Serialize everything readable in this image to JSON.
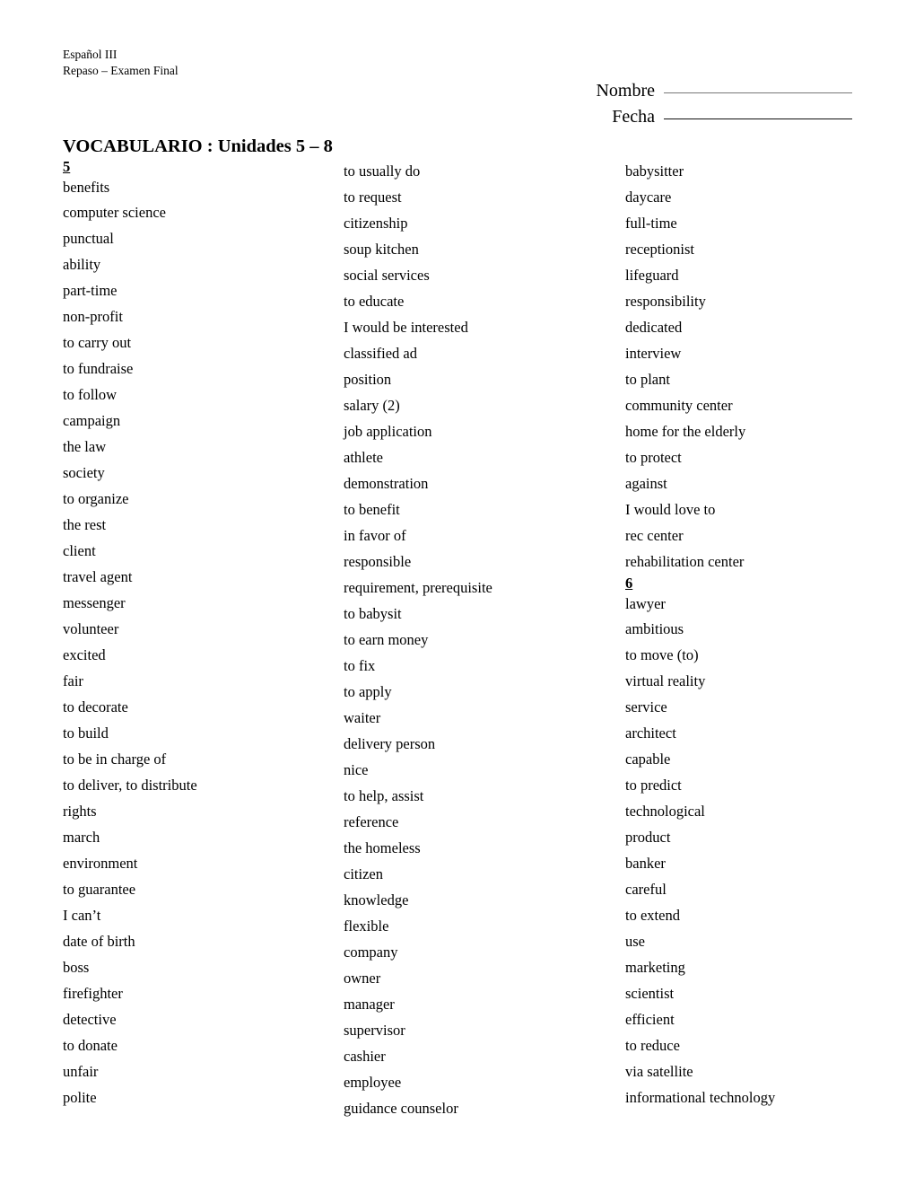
{
  "header": {
    "course": "Español III",
    "subtitle": "Repaso – Examen Final",
    "nombre_label": "Nombre",
    "fecha_label": "Fecha"
  },
  "title": "VOCABULARIO : Unidades 5 – 8",
  "columns": [
    {
      "id": "column-1",
      "items": [
        {
          "text": "5",
          "type": "section"
        },
        {
          "text": "benefits",
          "type": "word"
        },
        {
          "text": "computer science",
          "type": "word"
        },
        {
          "text": "punctual",
          "type": "word"
        },
        {
          "text": "ability",
          "type": "word"
        },
        {
          "text": "part-time",
          "type": "word"
        },
        {
          "text": "non-profit",
          "type": "word"
        },
        {
          "text": "to carry out",
          "type": "word"
        },
        {
          "text": "to fundraise",
          "type": "word"
        },
        {
          "text": "to follow",
          "type": "word"
        },
        {
          "text": "campaign",
          "type": "word"
        },
        {
          "text": "the law",
          "type": "word"
        },
        {
          "text": "society",
          "type": "word"
        },
        {
          "text": "to organize",
          "type": "word"
        },
        {
          "text": "the rest",
          "type": "word"
        },
        {
          "text": "client",
          "type": "word"
        },
        {
          "text": "travel agent",
          "type": "word"
        },
        {
          "text": "messenger",
          "type": "word"
        },
        {
          "text": "volunteer",
          "type": "word"
        },
        {
          "text": "excited",
          "type": "word"
        },
        {
          "text": "fair",
          "type": "word"
        },
        {
          "text": "to decorate",
          "type": "word"
        },
        {
          "text": "to build",
          "type": "word"
        },
        {
          "text": "to be in charge of",
          "type": "word"
        },
        {
          "text": "to deliver, to distribute",
          "type": "word"
        },
        {
          "text": "rights",
          "type": "word"
        },
        {
          "text": "march",
          "type": "word"
        },
        {
          "text": "environment",
          "type": "word"
        },
        {
          "text": "to guarantee",
          "type": "word"
        },
        {
          "text": "I can’t",
          "type": "word"
        },
        {
          "text": "date of birth",
          "type": "word"
        },
        {
          "text": "boss",
          "type": "word"
        },
        {
          "text": "firefighter",
          "type": "word"
        },
        {
          "text": "detective",
          "type": "word"
        },
        {
          "text": "to donate",
          "type": "word"
        },
        {
          "text": "unfair",
          "type": "word"
        },
        {
          "text": "polite",
          "type": "word"
        }
      ]
    },
    {
      "id": "column-2",
      "items": [
        {
          "text": "to usually do",
          "type": "word"
        },
        {
          "text": "to request",
          "type": "word"
        },
        {
          "text": "citizenship",
          "type": "word"
        },
        {
          "text": "soup kitchen",
          "type": "word"
        },
        {
          "text": "social services",
          "type": "word"
        },
        {
          "text": "to educate",
          "type": "word"
        },
        {
          "text": "I would be interested",
          "type": "word"
        },
        {
          "text": "classified ad",
          "type": "word"
        },
        {
          "text": "position",
          "type": "word"
        },
        {
          "text": "salary (2)",
          "type": "word"
        },
        {
          "text": "job application",
          "type": "word"
        },
        {
          "text": "athlete",
          "type": "word"
        },
        {
          "text": "demonstration",
          "type": "word"
        },
        {
          "text": "to benefit",
          "type": "word"
        },
        {
          "text": "in favor of",
          "type": "word"
        },
        {
          "text": "responsible",
          "type": "word"
        },
        {
          "text": "requirement, prerequisite",
          "type": "word"
        },
        {
          "text": "to babysit",
          "type": "word"
        },
        {
          "text": "to earn money",
          "type": "word"
        },
        {
          "text": "to fix",
          "type": "word"
        },
        {
          "text": "to apply",
          "type": "word"
        },
        {
          "text": "waiter",
          "type": "word"
        },
        {
          "text": "delivery person",
          "type": "word"
        },
        {
          "text": "nice",
          "type": "word"
        },
        {
          "text": "to help, assist",
          "type": "word"
        },
        {
          "text": "reference",
          "type": "word"
        },
        {
          "text": "the homeless",
          "type": "word"
        },
        {
          "text": "citizen",
          "type": "word"
        },
        {
          "text": "knowledge",
          "type": "word"
        },
        {
          "text": "flexible",
          "type": "word"
        },
        {
          "text": "company",
          "type": "word"
        },
        {
          "text": "owner",
          "type": "word"
        },
        {
          "text": "manager",
          "type": "word"
        },
        {
          "text": "supervisor",
          "type": "word"
        },
        {
          "text": "cashier",
          "type": "word"
        },
        {
          "text": "employee",
          "type": "word"
        },
        {
          "text": "guidance counselor",
          "type": "word"
        }
      ]
    },
    {
      "id": "column-3",
      "items": [
        {
          "text": "babysitter",
          "type": "word"
        },
        {
          "text": "daycare",
          "type": "word"
        },
        {
          "text": "full-time",
          "type": "word"
        },
        {
          "text": "receptionist",
          "type": "word"
        },
        {
          "text": "lifeguard",
          "type": "word"
        },
        {
          "text": "responsibility",
          "type": "word"
        },
        {
          "text": "dedicated",
          "type": "word"
        },
        {
          "text": "interview",
          "type": "word"
        },
        {
          "text": "to plant",
          "type": "word"
        },
        {
          "text": "community center",
          "type": "word"
        },
        {
          "text": "home for the elderly",
          "type": "word"
        },
        {
          "text": "to protect",
          "type": "word"
        },
        {
          "text": "against",
          "type": "word"
        },
        {
          "text": "I would love to",
          "type": "word"
        },
        {
          "text": "rec center",
          "type": "word"
        },
        {
          "text": "rehabilitation center",
          "type": "word"
        },
        {
          "text": "6",
          "type": "section"
        },
        {
          "text": "lawyer",
          "type": "word"
        },
        {
          "text": "ambitious",
          "type": "word"
        },
        {
          "text": "to move (to)",
          "type": "word"
        },
        {
          "text": "virtual reality",
          "type": "word"
        },
        {
          "text": "service",
          "type": "word"
        },
        {
          "text": "architect",
          "type": "word"
        },
        {
          "text": "capable",
          "type": "word"
        },
        {
          "text": "to predict",
          "type": "word"
        },
        {
          "text": "technological",
          "type": "word"
        },
        {
          "text": "product",
          "type": "word"
        },
        {
          "text": "banker",
          "type": "word"
        },
        {
          "text": "careful",
          "type": "word"
        },
        {
          "text": "to extend",
          "type": "word"
        },
        {
          "text": "use",
          "type": "word"
        },
        {
          "text": "marketing",
          "type": "word"
        },
        {
          "text": "scientist",
          "type": "word"
        },
        {
          "text": "efficient",
          "type": "word"
        },
        {
          "text": "to reduce",
          "type": "word"
        },
        {
          "text": "via satellite",
          "type": "word"
        },
        {
          "text": "informational technology",
          "type": "word"
        }
      ]
    }
  ]
}
